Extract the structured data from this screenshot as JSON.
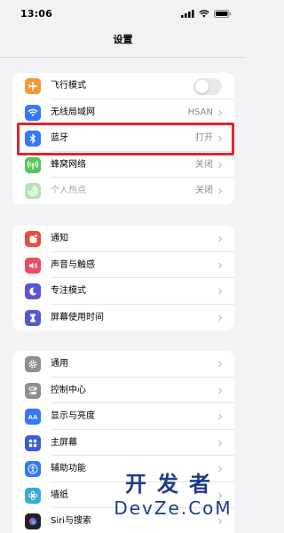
{
  "status_bar": {
    "time": "13:06"
  },
  "nav": {
    "title": "设置"
  },
  "groups": [
    {
      "rows": [
        {
          "label": "飞行模式",
          "value": "",
          "icon": "airplane-icon",
          "icon_color": "#f19a37",
          "control": "toggle",
          "toggle_on": false
        },
        {
          "label": "无线局域网",
          "value": "HSAN",
          "icon": "wifi-icon",
          "icon_color": "#3478f6",
          "control": "chevron"
        },
        {
          "label": "蓝牙",
          "value": "打开",
          "icon": "bluetooth-icon",
          "icon_color": "#3478f6",
          "control": "chevron"
        },
        {
          "label": "蜂窝网络",
          "value": "关闭",
          "icon": "cellular-icon",
          "icon_color": "#5ac45a",
          "control": "chevron"
        },
        {
          "label": "个人热点",
          "value": "关闭",
          "icon": "hotspot-icon",
          "icon_color": "#5ac45a",
          "control": "chevron",
          "dimmed": true
        }
      ]
    },
    {
      "rows": [
        {
          "label": "通知",
          "icon": "notifications-icon",
          "icon_color": "#eb4d3d",
          "control": "chevron"
        },
        {
          "label": "声音与触感",
          "icon": "sound-icon",
          "icon_color": "#eb4d5f",
          "control": "chevron"
        },
        {
          "label": "专注模式",
          "icon": "focus-moon-icon",
          "icon_color": "#5856d6",
          "control": "chevron"
        },
        {
          "label": "屏幕使用时间",
          "icon": "hourglass-icon",
          "icon_color": "#5856d6",
          "control": "chevron"
        }
      ]
    },
    {
      "rows": [
        {
          "label": "通用",
          "icon": "gear-icon",
          "icon_color": "#8e8e93",
          "control": "chevron"
        },
        {
          "label": "控制中心",
          "icon": "control-center-icon",
          "icon_color": "#8e8e93",
          "control": "chevron"
        },
        {
          "label": "显示与亮度",
          "icon": "display-icon",
          "icon_color": "#3478f6",
          "control": "chevron"
        },
        {
          "label": "主屏幕",
          "icon": "home-screen-icon",
          "icon_color": "#3b5bdb",
          "control": "chevron"
        },
        {
          "label": "辅助功能",
          "icon": "accessibility-icon",
          "icon_color": "#3478f6",
          "control": "chevron"
        },
        {
          "label": "墙纸",
          "icon": "wallpaper-icon",
          "icon_color": "#36aadc",
          "control": "chevron"
        },
        {
          "label": "Siri与搜索",
          "icon": "siri-icon",
          "icon_color": "#222222",
          "control": "chevron"
        }
      ]
    }
  ],
  "highlight_color": "#e3242b",
  "watermark": {
    "line1": "开发者",
    "line2": "DevZe.CoM"
  }
}
